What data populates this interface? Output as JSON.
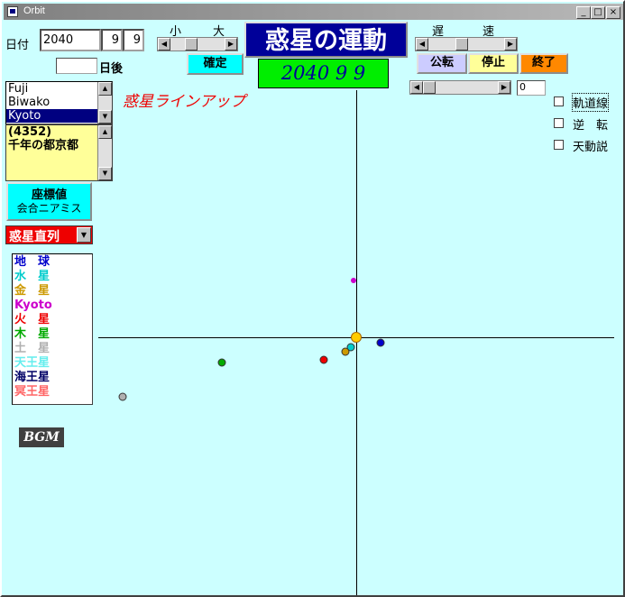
{
  "window": {
    "title": "Orbit",
    "min_label": "_",
    "max_label": "□",
    "close_label": "×"
  },
  "date": {
    "label": "日付",
    "year": "2040",
    "month": "9",
    "day": "9",
    "days_after_label": "日後",
    "days_after_value": ""
  },
  "zoom": {
    "small_label": "小",
    "large_label": "大",
    "confirm_label": "確定"
  },
  "main_title": "惑星の運動",
  "current_date_display": "2040 9 9",
  "speed": {
    "slow_label": "遅",
    "fast_label": "速"
  },
  "controls": {
    "revolve_label": "公転",
    "stop_label": "停止",
    "end_label": "終了"
  },
  "offset": {
    "value": "0"
  },
  "options": [
    {
      "label": "軌道線",
      "checked": false
    },
    {
      "label": "逆　転",
      "checked": false
    },
    {
      "label": "天動説",
      "checked": false
    }
  ],
  "location_list": {
    "items": [
      "Fuji",
      "Biwako",
      "Kyoto"
    ],
    "selected": "Kyoto"
  },
  "description": {
    "line1": "(4352)",
    "line2": "千年の都京都"
  },
  "lineup_title": "惑星ラインアップ",
  "coords_button": {
    "line1": "座標値",
    "line2": "会合ニアミス"
  },
  "alignment_select": {
    "value": "惑星直列"
  },
  "planet_legend": [
    {
      "name": "地　球",
      "color": "#0000cc"
    },
    {
      "name": "水　星",
      "color": "#00cccc"
    },
    {
      "name": "金　星",
      "color": "#cc9900"
    },
    {
      "name": "Kyoto",
      "color": "#cc00cc"
    },
    {
      "name": "火　星",
      "color": "#ee0000"
    },
    {
      "name": "木　星",
      "color": "#00aa00"
    },
    {
      "name": "土　星",
      "color": "#b0b0b0"
    },
    {
      "name": "天王星",
      "color": "#66eeee"
    },
    {
      "name": "海王星",
      "color": "#000066"
    },
    {
      "name": "冥王星",
      "color": "#ff6666"
    }
  ],
  "bgm_label": "BGM",
  "colors": {
    "background": "#ccffff",
    "title_bg": "#000099",
    "date_display_bg": "#00ee00",
    "cyan_button": "#00ffff",
    "revolve_btn": "#ccccff",
    "stop_btn": "#ffff99",
    "end_btn": "#ff8800",
    "select_bg": "#ee0000"
  }
}
